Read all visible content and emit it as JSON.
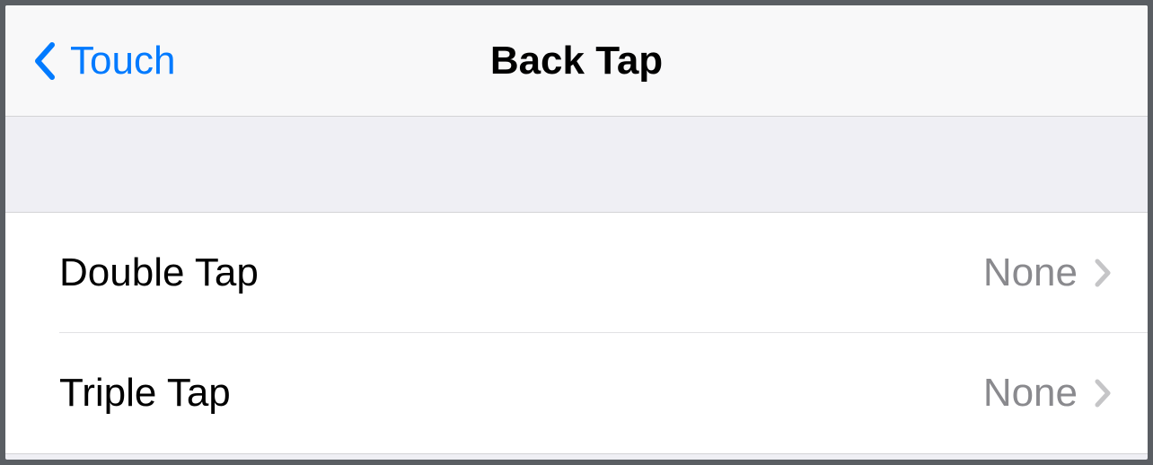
{
  "nav": {
    "back_label": "Touch",
    "title": "Back Tap"
  },
  "rows": [
    {
      "label": "Double Tap",
      "value": "None"
    },
    {
      "label": "Triple Tap",
      "value": "None"
    }
  ]
}
